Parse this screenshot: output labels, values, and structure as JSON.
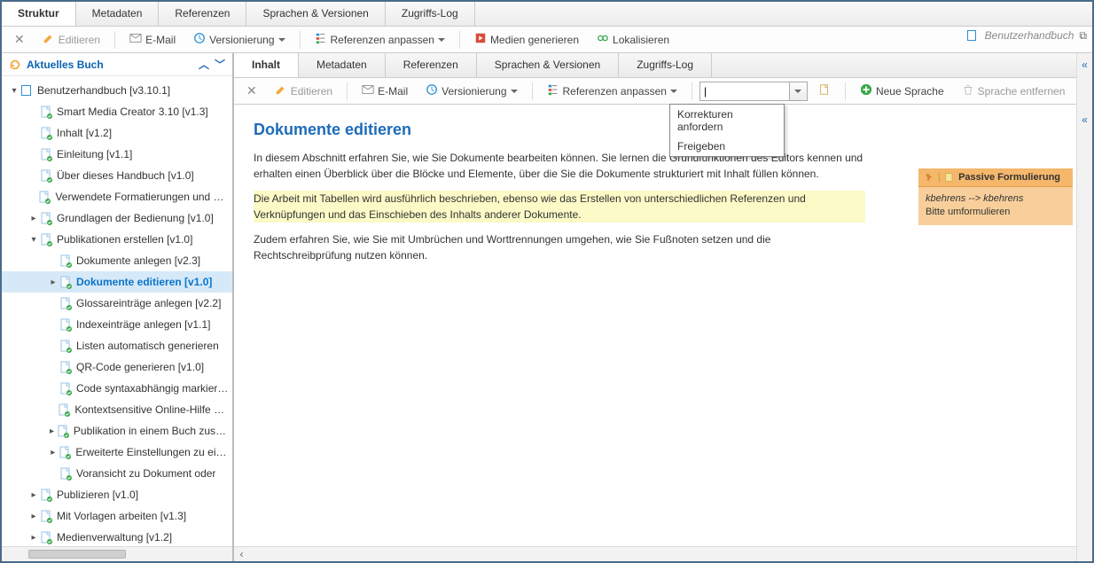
{
  "outer_tabs": [
    "Struktur",
    "Metadaten",
    "Referenzen",
    "Sprachen & Versionen",
    "Zugriffs-Log"
  ],
  "outer_active": 0,
  "outer_toolbar": {
    "close": "✕",
    "edit": "Editieren",
    "email": "E-Mail",
    "versioning": "Versionierung",
    "refs": "Referenzen anpassen",
    "media": "Medien generieren",
    "localize": "Lokalisieren",
    "manual": "Benutzerhandbuch"
  },
  "left": {
    "title": "Aktuelles Buch",
    "tree": [
      {
        "d": 0,
        "tw": "▾",
        "kind": "book",
        "label": "Benutzerhandbuch [v3.10.1]"
      },
      {
        "d": 1,
        "tw": "",
        "kind": "doc",
        "label": "Smart Media Creator 3.10 [v1.3]"
      },
      {
        "d": 1,
        "tw": "",
        "kind": "doc",
        "label": "Inhalt [v1.2]"
      },
      {
        "d": 1,
        "tw": "",
        "kind": "doc",
        "label": "Einleitung [v1.1]"
      },
      {
        "d": 1,
        "tw": "",
        "kind": "doc",
        "label": "Über dieses Handbuch [v1.0]"
      },
      {
        "d": 1,
        "tw": "",
        "kind": "doc",
        "label": "Verwendete Formatierungen und Symbole"
      },
      {
        "d": 1,
        "tw": "▸",
        "kind": "doc",
        "label": "Grundlagen der Bedienung [v1.0]"
      },
      {
        "d": 1,
        "tw": "▾",
        "kind": "doc",
        "label": "Publikationen erstellen [v1.0]"
      },
      {
        "d": 2,
        "tw": "",
        "kind": "doc",
        "label": "Dokumente anlegen [v2.3]"
      },
      {
        "d": 2,
        "tw": "▸",
        "kind": "doc",
        "label": "Dokumente editieren [v1.0]",
        "sel": true
      },
      {
        "d": 2,
        "tw": "",
        "kind": "doc",
        "label": "Glossareinträge anlegen [v2.2]"
      },
      {
        "d": 2,
        "tw": "",
        "kind": "doc",
        "label": "Indexeinträge anlegen [v1.1]"
      },
      {
        "d": 2,
        "tw": "",
        "kind": "doc",
        "label": "Listen automatisch generieren"
      },
      {
        "d": 2,
        "tw": "",
        "kind": "doc",
        "label": "QR-Code generieren [v1.0]"
      },
      {
        "d": 2,
        "tw": "",
        "kind": "doc",
        "label": "Code syntaxabhängig markieren"
      },
      {
        "d": 2,
        "tw": "",
        "kind": "doc",
        "label": "Kontextsensitive Online-Hilfe erstellen"
      },
      {
        "d": 2,
        "tw": "▸",
        "kind": "doc",
        "label": "Publikation in einem Buch zusammenfassen"
      },
      {
        "d": 2,
        "tw": "▸",
        "kind": "doc",
        "label": "Erweiterte Einstellungen zu einem"
      },
      {
        "d": 2,
        "tw": "",
        "kind": "doc",
        "label": "Voransicht zu Dokument oder"
      },
      {
        "d": 1,
        "tw": "▸",
        "kind": "doc",
        "label": "Publizieren [v1.0]"
      },
      {
        "d": 1,
        "tw": "▸",
        "kind": "doc",
        "label": "Mit Vorlagen arbeiten [v1.3]"
      },
      {
        "d": 1,
        "tw": "▸",
        "kind": "doc",
        "label": "Medienverwaltung [v1.2]"
      }
    ]
  },
  "inner_tabs": [
    "Inhalt",
    "Metadaten",
    "Referenzen",
    "Sprachen & Versionen",
    "Zugriffs-Log"
  ],
  "inner_active": 0,
  "inner_toolbar": {
    "edit": "Editieren",
    "email": "E-Mail",
    "versioning": "Versionierung",
    "refs": "Referenzen anpassen",
    "combo_value": "|",
    "new_lang": "Neue Sprache",
    "del_lang": "Sprache entfernen"
  },
  "dropdown": {
    "items": [
      "Korrekturen anfordern",
      "Freigeben"
    ]
  },
  "document": {
    "title": "Dokumente editieren",
    "p1": "In diesem Abschnitt erfahren Sie, wie Sie Dokumente bearbeiten können. Sie lernen die Grundfunktionen des Editors kennen und erhalten einen Überblick über die Blöcke und Elemente, über die Sie die Dokumente strukturiert mit Inhalt füllen können.",
    "p2": "Die Arbeit mit Tabellen wird ausführlich beschrieben, ebenso wie das Erstellen von unterschiedlichen Referenzen und Verknüpfungen und das Einschieben des Inhalts anderer Dokumente.",
    "p3": "Zudem erfahren Sie, wie Sie mit Umbrüchen und Worttrennungen umgehen, wie Sie Fußnoten setzen und die Rechtschreibprüfung nutzen können."
  },
  "comment": {
    "title": "Passive Formulierung",
    "author_line": "kbehrens --> kbehrens",
    "body": "Bitte umformulieren"
  }
}
